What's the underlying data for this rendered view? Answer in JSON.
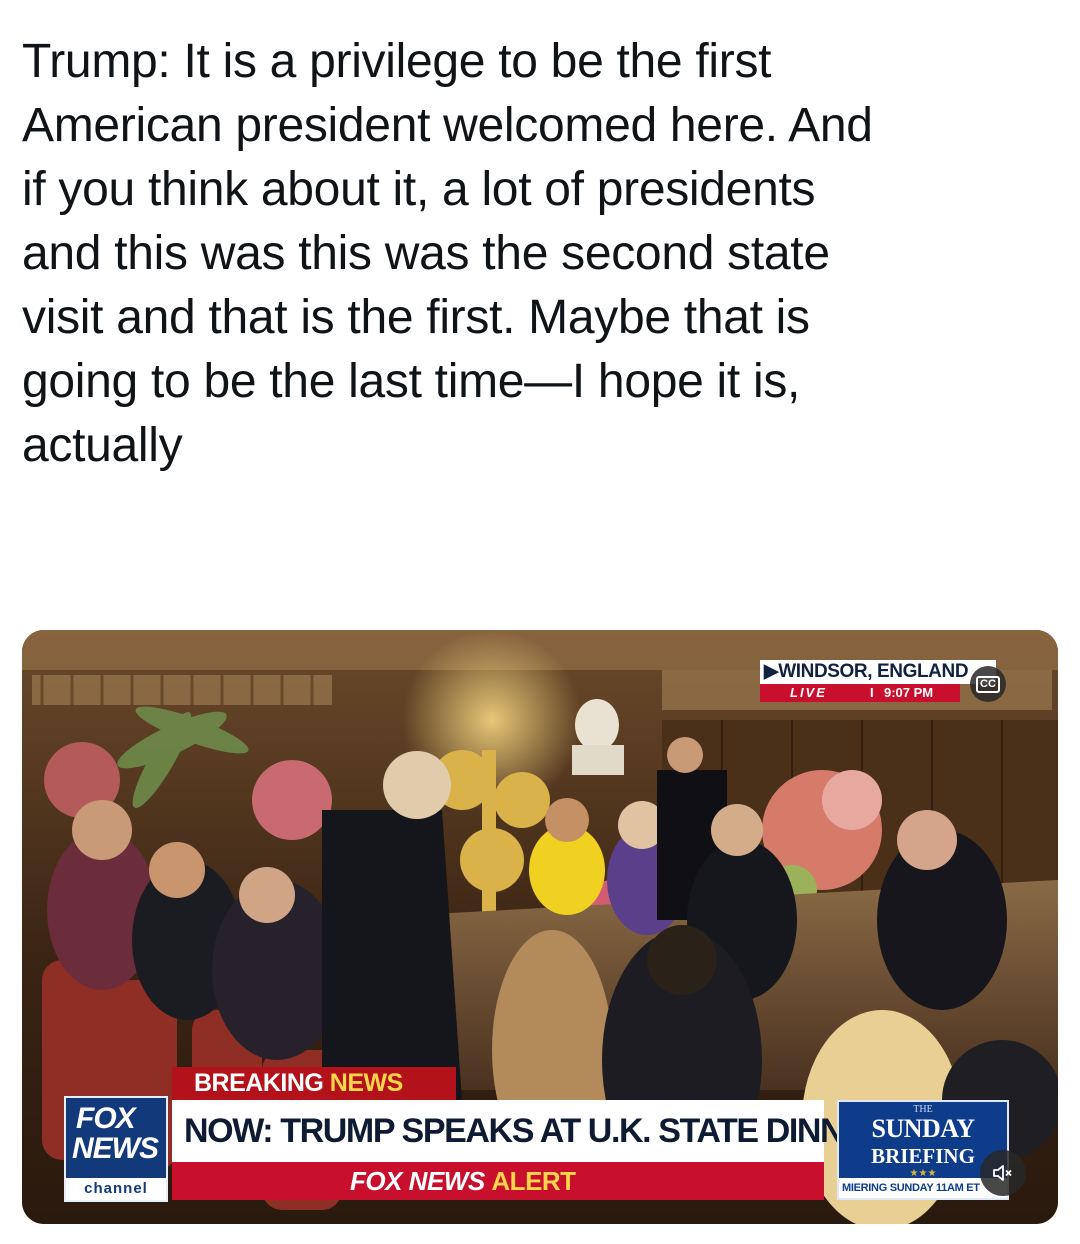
{
  "tweet": {
    "text": "Trump: It is a privilege to be the first\nAmerican president welcomed here. And\nif you think about it, a lot of presidents\nand this was this was the second state\nvisit and that is the first. Maybe that is\ngoing to be the last time—I hope it is,\nactually"
  },
  "media": {
    "location_badge": {
      "location": "WINDSOR, ENGLAND",
      "live_label": "LIVE",
      "separator": "I",
      "time": "9:07 PM"
    },
    "cc_label": "CC",
    "lower_third": {
      "breaking_prefix": "BREAKING",
      "breaking_suffix": "NEWS",
      "headline": "NOW: TRUMP SPEAKS AT U.K. STATE DINNER",
      "alert_prefix": "FOX NEWS",
      "alert_suffix": "ALERT",
      "network_logo_line1": "FOX",
      "network_logo_line2": "NEWS",
      "network_logo_line3": "channel"
    },
    "promo": {
      "the": "THE",
      "line1": "SUNDAY",
      "line2": "BRIEFING",
      "stars": "★★★",
      "schedule": "MIERING SUNDAY 11AM ET"
    },
    "icons": [
      "cc-icon",
      "speaker-muted-icon"
    ],
    "colors": {
      "fox_red": "#c8102e",
      "fox_blue": "#123a7a",
      "alert_yellow": "#ffd54a"
    }
  }
}
